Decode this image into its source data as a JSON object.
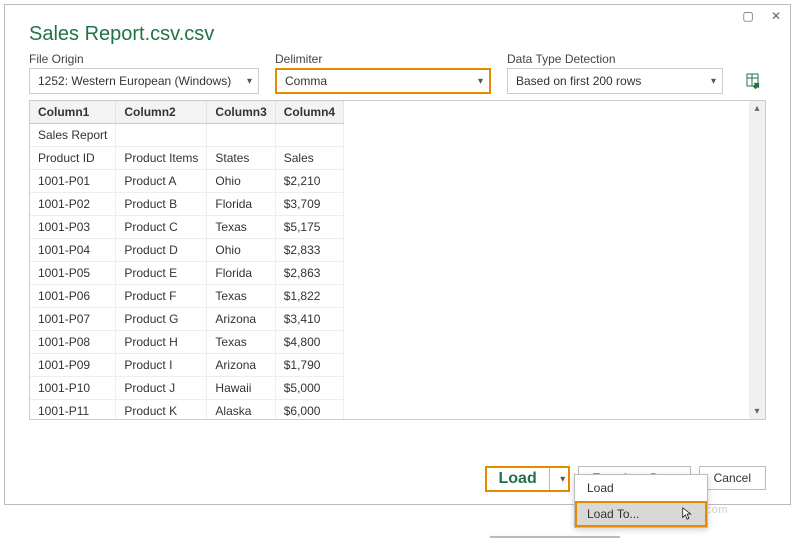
{
  "titlebar": {
    "maximize_glyph": "▢",
    "close_glyph": "✕"
  },
  "dialog": {
    "title": "Sales Report.csv.csv"
  },
  "file_origin": {
    "label": "File Origin",
    "value": "1252: Western European (Windows)"
  },
  "delimiter": {
    "label": "Delimiter",
    "value": "Comma"
  },
  "detection": {
    "label": "Data Type Detection",
    "value": "Based on first 200 rows"
  },
  "headers": [
    "Column1",
    "Column2",
    "Column3",
    "Column4"
  ],
  "rows": [
    [
      "Sales Report",
      "",
      "",
      ""
    ],
    [
      "Product ID",
      "Product Items",
      "States",
      "Sales"
    ],
    [
      "1001-P01",
      "Product A",
      "Ohio",
      "$2,210"
    ],
    [
      "1001-P02",
      "Product B",
      "Florida",
      "$3,709"
    ],
    [
      "1001-P03",
      "Product C",
      "Texas",
      "$5,175"
    ],
    [
      "1001-P04",
      "Product D",
      "Ohio",
      "$2,833"
    ],
    [
      "1001-P05",
      "Product E",
      "Florida",
      "$2,863"
    ],
    [
      "1001-P06",
      "Product F",
      "Texas",
      "$1,822"
    ],
    [
      "1001-P07",
      "Product G",
      "Arizona",
      "$3,410"
    ],
    [
      "1001-P08",
      "Product H",
      "Texas",
      "$4,800"
    ],
    [
      "1001-P09",
      "Product I",
      "Arizona",
      "$1,790"
    ],
    [
      "1001-P10",
      "Product J",
      "Hawaii",
      "$5,000"
    ],
    [
      "1001-P11",
      "Product K",
      "Alaska",
      "$6,000"
    ]
  ],
  "buttons": {
    "load": "Load",
    "transform": "Transform Data",
    "cancel": "Cancel"
  },
  "menu": {
    "load": "Load",
    "load_to": "Load To..."
  },
  "watermark": "wsxdn.com"
}
